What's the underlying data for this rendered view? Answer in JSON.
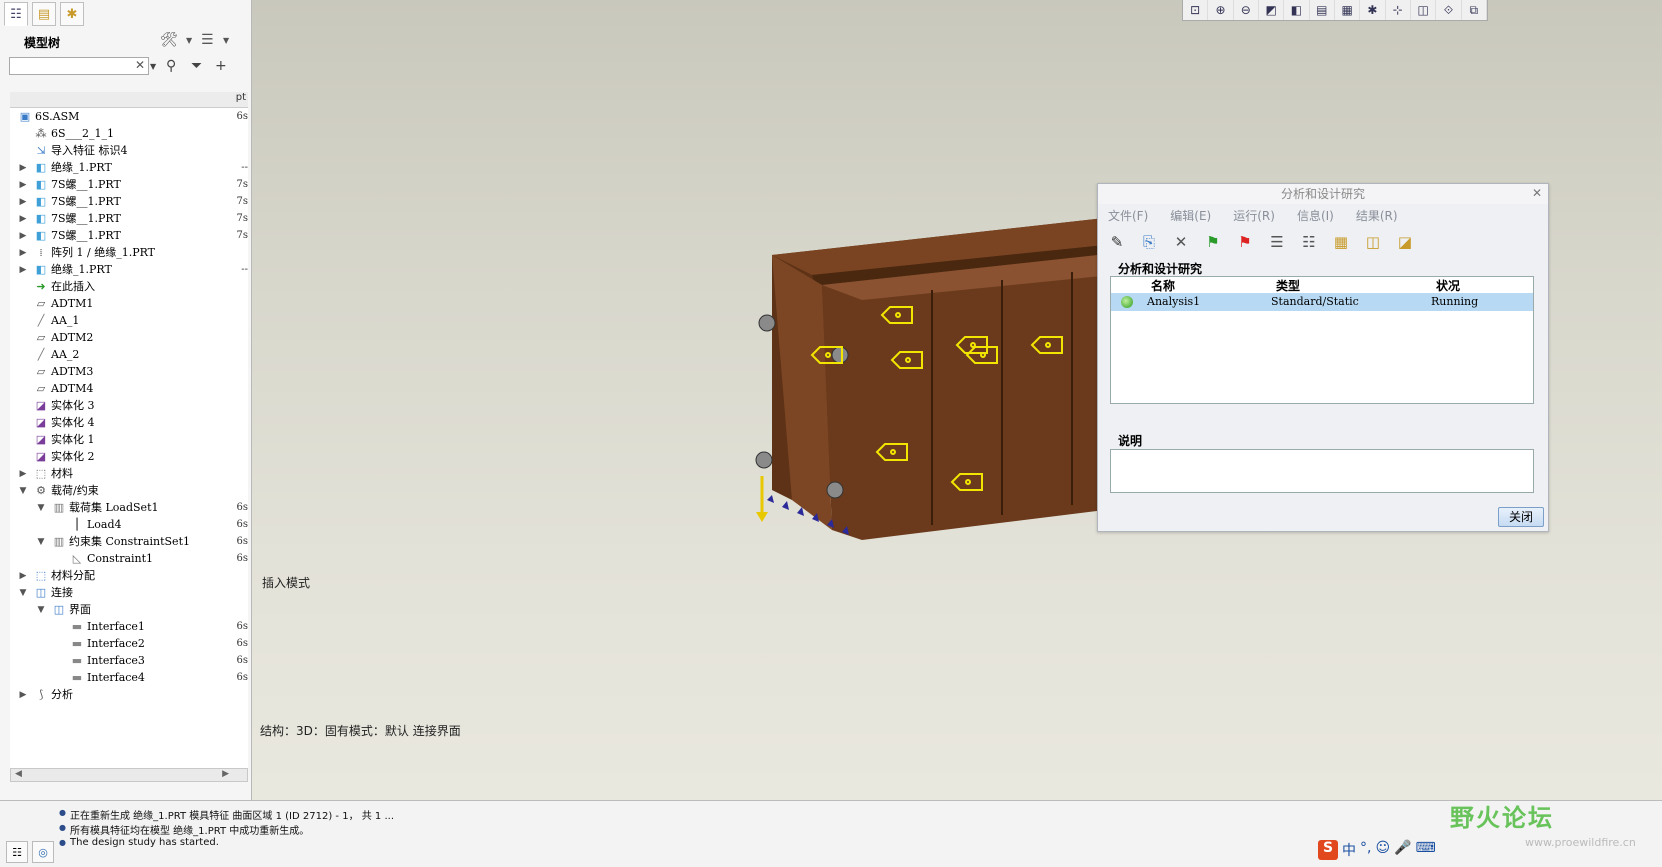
{
  "left_panel": {
    "tabs": [
      "model-tree-tab",
      "folder-tab",
      "favorites-tab"
    ],
    "title": "模型树",
    "search_value": "",
    "tree_col_header": "pt",
    "tree": [
      {
        "label": "6S.ASM",
        "c2": "6s",
        "indent": 0,
        "exp": "",
        "icon": "asm"
      },
      {
        "label": "6S___2_1_1",
        "c2": "",
        "indent": 1,
        "exp": "",
        "icon": "coord"
      },
      {
        "label": "导入特征 标识4",
        "c2": "",
        "indent": 1,
        "exp": "",
        "icon": "import"
      },
      {
        "label": "绝缘_1.PRT",
        "c2": "--",
        "indent": 1,
        "exp": "▶",
        "icon": "part"
      },
      {
        "label": "7S螺__1.PRT",
        "c2": "7s",
        "indent": 1,
        "exp": "▶",
        "icon": "part"
      },
      {
        "label": "7S螺__1.PRT",
        "c2": "7s",
        "indent": 1,
        "exp": "▶",
        "icon": "part"
      },
      {
        "label": "7S螺__1.PRT",
        "c2": "7s",
        "indent": 1,
        "exp": "▶",
        "icon": "part"
      },
      {
        "label": "7S螺__1.PRT",
        "c2": "7s",
        "indent": 1,
        "exp": "▶",
        "icon": "part"
      },
      {
        "label": "阵列 1 / 绝缘_1.PRT",
        "c2": "",
        "indent": 1,
        "exp": "▶",
        "icon": "pattern"
      },
      {
        "label": "绝缘_1.PRT",
        "c2": "--",
        "indent": 1,
        "exp": "▶",
        "icon": "part"
      },
      {
        "label": "在此插入",
        "c2": "",
        "indent": 1,
        "exp": "",
        "icon": "insert"
      },
      {
        "label": "ADTM1",
        "c2": "",
        "indent": 1,
        "exp": "",
        "icon": "plane"
      },
      {
        "label": "AA_1",
        "c2": "",
        "indent": 1,
        "exp": "",
        "icon": "axis"
      },
      {
        "label": "ADTM2",
        "c2": "",
        "indent": 1,
        "exp": "",
        "icon": "plane"
      },
      {
        "label": "AA_2",
        "c2": "",
        "indent": 1,
        "exp": "",
        "icon": "axis"
      },
      {
        "label": "ADTM3",
        "c2": "",
        "indent": 1,
        "exp": "",
        "icon": "plane"
      },
      {
        "label": "ADTM4",
        "c2": "",
        "indent": 1,
        "exp": "",
        "icon": "plane"
      },
      {
        "label": "实体化 3",
        "c2": "",
        "indent": 1,
        "exp": "",
        "icon": "solidify"
      },
      {
        "label": "实体化 4",
        "c2": "",
        "indent": 1,
        "exp": "",
        "icon": "solidify"
      },
      {
        "label": "实体化 1",
        "c2": "",
        "indent": 1,
        "exp": "",
        "icon": "solidify"
      },
      {
        "label": "实体化 2",
        "c2": "",
        "indent": 1,
        "exp": "",
        "icon": "solidify"
      },
      {
        "label": "材料",
        "c2": "",
        "indent": 1,
        "exp": "▶",
        "icon": "material"
      },
      {
        "label": "载荷/约束",
        "c2": "",
        "indent": 1,
        "exp": "▼",
        "icon": "load"
      },
      {
        "label": "载荷集 LoadSet1",
        "c2": "6s",
        "indent": 2,
        "exp": "▼",
        "icon": "loadset"
      },
      {
        "label": "Load4",
        "c2": "6s",
        "indent": 3,
        "exp": "",
        "icon": "loaditem"
      },
      {
        "label": "约束集 ConstraintSet1",
        "c2": "6s",
        "indent": 2,
        "exp": "▼",
        "icon": "conset"
      },
      {
        "label": "Constraint1",
        "c2": "6s",
        "indent": 3,
        "exp": "",
        "icon": "conitem"
      },
      {
        "label": "材料分配",
        "c2": "",
        "indent": 1,
        "exp": "▶",
        "icon": "matassign"
      },
      {
        "label": "连接",
        "c2": "",
        "indent": 1,
        "exp": "▼",
        "icon": "connection"
      },
      {
        "label": "界面",
        "c2": "",
        "indent": 2,
        "exp": "▼",
        "icon": "interface-group"
      },
      {
        "label": "Interface1",
        "c2": "6s",
        "indent": 3,
        "exp": "",
        "icon": "interface"
      },
      {
        "label": "Interface2",
        "c2": "6s",
        "indent": 3,
        "exp": "",
        "icon": "interface"
      },
      {
        "label": "Interface3",
        "c2": "6s",
        "indent": 3,
        "exp": "",
        "icon": "interface"
      },
      {
        "label": "Interface4",
        "c2": "6s",
        "indent": 3,
        "exp": "",
        "icon": "interface"
      },
      {
        "label": "分析",
        "c2": "",
        "indent": 1,
        "exp": "▶",
        "icon": "analysis"
      }
    ]
  },
  "viewport": {
    "toolbar_icons": [
      "refit-icon",
      "zoom-in-icon",
      "zoom-out-icon",
      "repaint-icon",
      "shading-icon",
      "view-manager-icon",
      "saved-views-icon",
      "datum-display-icon",
      "spin-center-icon",
      "annotation-icon",
      "simulation-display-icon",
      "highlight-icon"
    ],
    "insert_mode": "插入模式",
    "struct_status": "结构：3D：固有模式：默认 连接界面",
    "colors": {
      "model": "#6b3a1c",
      "tag": "#f2e600",
      "constraint": "#2a2a9a"
    }
  },
  "dialog": {
    "title": "分析和设计研究",
    "menu": [
      "文件(F)",
      "编辑(E)",
      "运行(R)",
      "信息(I)",
      "结果(R)"
    ],
    "tools": [
      "edit-icon",
      "copy-icon",
      "delete-icon",
      "start-run-icon",
      "stop-run-icon",
      "status-icon",
      "summary-icon",
      "results-icon",
      "optimize-icon",
      "review-icon"
    ],
    "group_label": "分析和设计研究",
    "columns": [
      "名称",
      "类型",
      "状况"
    ],
    "row": {
      "name": "Analysis1",
      "type": "Standard/Static",
      "status": "Running"
    },
    "desc_label": "说明",
    "close_label": "关闭"
  },
  "messages": [
    "正在重新生成 绝缘_1.PRT 模具特征 曲面区域 1 (ID 2712) - 1， 共 1 ...",
    "所有模具特征均在模型 绝缘_1.PRT 中成功重新生成。",
    "The design study has started."
  ],
  "watermark": {
    "text": "野火论坛",
    "url": "www.proewildfire.cn"
  },
  "ime": {
    "logo": "S",
    "lang": "中"
  }
}
